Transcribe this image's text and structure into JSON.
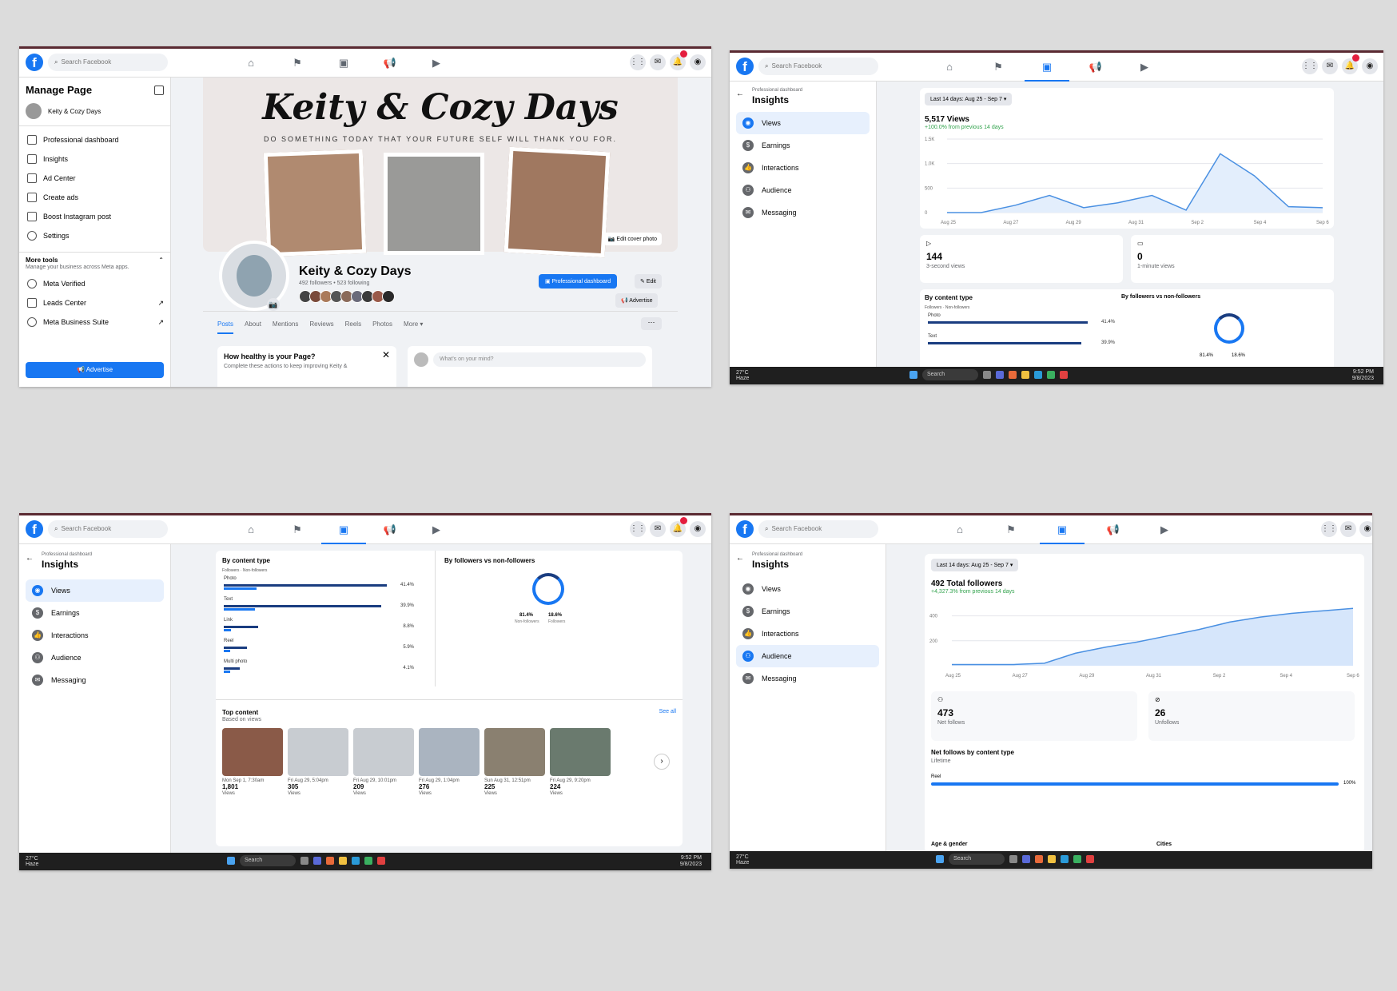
{
  "common": {
    "search_placeholder": "Search Facebook",
    "taskbar": {
      "temp": "27°C",
      "weather": "Haze",
      "search": "Search",
      "time": "9:52 PM",
      "date": "9/8/2023"
    }
  },
  "s1": {
    "sidebar_title": "Manage Page",
    "page_name": "Keity & Cozy Days",
    "menu": [
      {
        "label": "Professional dashboard",
        "icon": "dashboard-icon"
      },
      {
        "label": "Insights",
        "icon": "insights-icon"
      },
      {
        "label": "Ad Center",
        "icon": "megaphone-icon"
      },
      {
        "label": "Create ads",
        "icon": "pencil-icon"
      },
      {
        "label": "Boost Instagram post",
        "icon": "instagram-icon"
      },
      {
        "label": "Settings",
        "icon": "gear-icon"
      }
    ],
    "more_tools_title": "More tools",
    "more_tools_sub": "Manage your business across Meta apps.",
    "tools": [
      {
        "label": "Meta Verified"
      },
      {
        "label": "Leads Center"
      },
      {
        "label": "Meta Business Suite"
      }
    ],
    "advertise_button": "Advertise",
    "cover_title": "Keity & Cozy Days",
    "cover_tagline": "DO SOMETHING TODAY THAT YOUR FUTURE SELF WILL THANK YOU FOR.",
    "edit_cover": "Edit cover photo",
    "profile_name": "Keity & Cozy Days",
    "profile_stats": "492 followers • 523 following",
    "pro_dashboard_button": "Professional dashboard",
    "edit_button": "Edit",
    "advertise_small": "Advertise",
    "tabs": [
      "Posts",
      "About",
      "Mentions",
      "Reviews",
      "Reels",
      "Photos",
      "More ▾"
    ],
    "health_title": "How healthy is your Page?",
    "health_sub": "Complete these actions to keep improving Keity &",
    "composer_placeholder": "What's on your mind?"
  },
  "s2": {
    "breadcrumb": "Professional dashboard",
    "title": "Insights",
    "nav": [
      {
        "label": "Views",
        "selected": true
      },
      {
        "label": "Earnings"
      },
      {
        "label": "Interactions"
      },
      {
        "label": "Audience"
      },
      {
        "label": "Messaging"
      }
    ],
    "date_range": "Last 14 days: Aug 25 - Sep 7",
    "metric": "5,517 Views",
    "change": "+100.0% from previous 14 days",
    "stat1_value": "144",
    "stat1_label": "3-second views",
    "stat2_value": "0",
    "stat2_label": "1-minute views",
    "by_content": "By content type",
    "legend_followers": "Followers",
    "legend_nonfollowers": "Non-followers",
    "bars": [
      {
        "label": "Photo",
        "pct": "41.4%"
      },
      {
        "label": "Text",
        "pct": "39.9%"
      }
    ],
    "by_followers": "By followers vs non-followers",
    "donut_a": "81.4%",
    "donut_b": "18.6%"
  },
  "chart_views": {
    "type": "line",
    "x": [
      "Aug 25",
      "Aug 27",
      "Aug 29",
      "Aug 31",
      "Sep 2",
      "Sep 4",
      "Sep 6"
    ],
    "y_ticks": [
      "1.5K",
      "1.0K",
      "500",
      "0"
    ],
    "points": [
      [
        0,
        0
      ],
      [
        1,
        0
      ],
      [
        2,
        150
      ],
      [
        3,
        350
      ],
      [
        4,
        100
      ],
      [
        5,
        200
      ],
      [
        6,
        350
      ],
      [
        7,
        50
      ],
      [
        8,
        1200
      ],
      [
        9,
        750
      ],
      [
        10,
        120
      ],
      [
        11,
        100
      ]
    ],
    "ylim": [
      0,
      1500
    ]
  },
  "s3": {
    "breadcrumb": "Professional dashboard",
    "title": "Insights",
    "nav": [
      {
        "label": "Views",
        "selected": true
      },
      {
        "label": "Earnings"
      },
      {
        "label": "Interactions"
      },
      {
        "label": "Audience"
      },
      {
        "label": "Messaging"
      }
    ],
    "by_content": "By content type",
    "legend_followers": "Followers",
    "legend_nonfollowers": "Non-followers",
    "bars": [
      {
        "label": "Photo",
        "pct": "41.4%",
        "value": 41.4
      },
      {
        "label": "Text",
        "pct": "39.9%",
        "value": 39.9
      },
      {
        "label": "Link",
        "pct": "8.8%",
        "value": 8.8
      },
      {
        "label": "Reel",
        "pct": "5.9%",
        "value": 5.9
      },
      {
        "label": "Multi photo",
        "pct": "4.1%",
        "value": 4.1
      }
    ],
    "by_followers": "By followers vs non-followers",
    "donut_a": "81.4%",
    "donut_a_label": "Non-followers",
    "donut_b": "18.6%",
    "donut_b_label": "Followers",
    "top_content": "Top content",
    "top_sub": "Based on views",
    "see_all": "See all",
    "items": [
      {
        "date": "Mon Sep 1, 7:30am",
        "views": "1,801",
        "lbl": "Views",
        "color": "#8a5a48"
      },
      {
        "date": "Fri Aug 29, 5:04pm",
        "views": "305",
        "lbl": "Views",
        "color": "#c8ccd1"
      },
      {
        "date": "Fri Aug 29, 10:01pm",
        "views": "209",
        "lbl": "Views",
        "color": "#c8ccd1"
      },
      {
        "date": "Fri Aug 29, 1:04pm",
        "views": "276",
        "lbl": "Views",
        "color": "#aab4c0"
      },
      {
        "date": "Sun Aug 31, 12:51pm",
        "views": "225",
        "lbl": "Views",
        "color": "#8a8070"
      },
      {
        "date": "Fri Aug 29, 9:20pm",
        "views": "224",
        "lbl": "Views",
        "color": "#6a7a6e"
      }
    ]
  },
  "s4": {
    "breadcrumb": "Professional dashboard",
    "title": "Insights",
    "nav": [
      {
        "label": "Views"
      },
      {
        "label": "Earnings"
      },
      {
        "label": "Interactions"
      },
      {
        "label": "Audience",
        "selected": true
      },
      {
        "label": "Messaging"
      }
    ],
    "date_range": "Last 14 days: Aug 25 - Sep 7",
    "metric": "492 Total followers",
    "change": "+4,327.3% from previous 14 days",
    "stat1_value": "473",
    "stat1_label": "Net follows",
    "stat2_value": "26",
    "stat2_label": "Unfollows",
    "net_title": "Net follows by content type",
    "net_sub": "Lifetime",
    "net_bar_label": "Reel",
    "net_bar_pct": "100%",
    "age_gender": "Age & gender",
    "cities": "Cities"
  },
  "chart_followers": {
    "type": "area",
    "x": [
      "Aug 25",
      "Aug 27",
      "Aug 29",
      "Aug 31",
      "Sep 2",
      "Sep 4",
      "Sep 6"
    ],
    "y_ticks": [
      "400",
      "200"
    ],
    "points": [
      [
        0,
        10
      ],
      [
        1,
        10
      ],
      [
        2,
        10
      ],
      [
        3,
        20
      ],
      [
        4,
        100
      ],
      [
        5,
        150
      ],
      [
        6,
        190
      ],
      [
        7,
        240
      ],
      [
        8,
        290
      ],
      [
        9,
        350
      ],
      [
        10,
        390
      ],
      [
        11,
        420
      ],
      [
        12,
        440
      ],
      [
        13,
        460
      ]
    ],
    "ylim": [
      0,
      500
    ]
  },
  "colors": {
    "brand": "#1877f2",
    "dark_bar": "#1a3d80",
    "green": "#31a24c"
  }
}
